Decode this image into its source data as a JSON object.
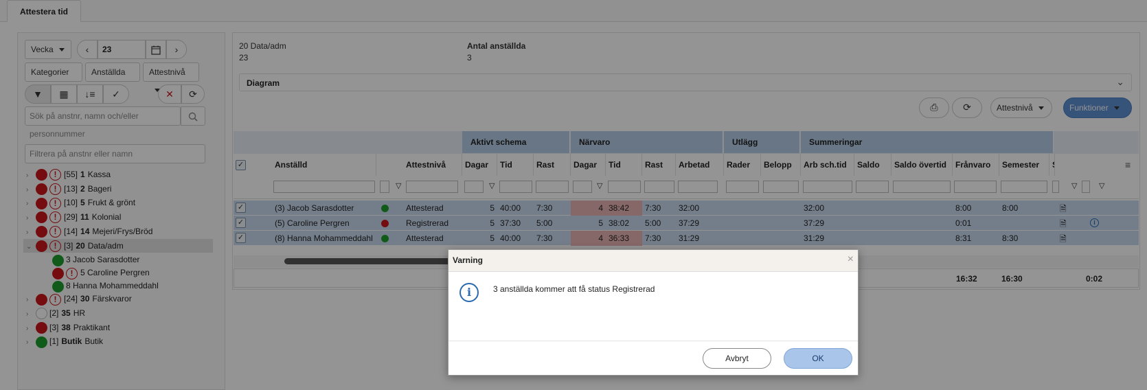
{
  "tab": {
    "label": "Attestera tid"
  },
  "filter": {
    "period": "Vecka",
    "week": "23",
    "kategorier": "Kategorier",
    "anstallda": "Anställda",
    "attestniva": "Attestnivå",
    "search_placeholder": "Sök på anstnr, namn och/eller personnummer",
    "filter_placeholder": "Filtrera på anstnr eller namn"
  },
  "tree": [
    {
      "count": "[55]",
      "code": "1",
      "name": "Kassa",
      "dots": [
        "red",
        "warn"
      ]
    },
    {
      "count": "[13]",
      "code": "2",
      "name": "Bageri",
      "dots": [
        "red",
        "warn"
      ]
    },
    {
      "count": "[10]",
      "code": "5",
      "name": "Frukt & grönt",
      "dots": [
        "red",
        "warn"
      ]
    },
    {
      "count": "[29]",
      "code": "11",
      "name": "Kolonial",
      "dots": [
        "red",
        "warn"
      ]
    },
    {
      "count": "[14]",
      "code": "14",
      "name": "Mejeri/Frys/Bröd",
      "dots": [
        "red",
        "warn"
      ]
    },
    {
      "count": "[3]",
      "code": "20",
      "name": "Data/adm",
      "dots": [
        "red",
        "warn"
      ],
      "expanded": true
    },
    {
      "count": "[24]",
      "code": "30",
      "name": "Färskvaror",
      "dots": [
        "red",
        "warn"
      ]
    },
    {
      "count": "[2]",
      "code": "35",
      "name": "HR",
      "dots": [
        "gray"
      ]
    },
    {
      "count": "[3]",
      "code": "38",
      "name": "Praktikant",
      "dots": [
        "red"
      ]
    },
    {
      "count": "[1]",
      "code": "Butik",
      "name": "Butik",
      "dots": [
        "green"
      ]
    }
  ],
  "tree_children": [
    {
      "label": "3 Jacob Sarasdotter",
      "dot": "green"
    },
    {
      "label": "5 Caroline Pergren",
      "dot": "red"
    },
    {
      "label": "8 Hanna Mohammeddahl",
      "dot": "green"
    }
  ],
  "summary": {
    "group_label": "20 Data/adm",
    "group_value": "23",
    "count_label": "Antal anställda",
    "count_value": "3",
    "diagram": "Diagram"
  },
  "toolbar": {
    "attestniva": "Attestnivå",
    "funktioner": "Funktioner"
  },
  "grid": {
    "groups": [
      "Aktivt schema",
      "Närvaro",
      "Utlägg",
      "Summeringar"
    ],
    "columns": [
      "Anställd",
      "Attestnivå",
      "Dagar",
      "Tid",
      "Rast",
      "Dagar",
      "Tid",
      "Rast",
      "Arbetad",
      "Rader",
      "Belopp",
      "Arb sch.tid",
      "Saldo",
      "Saldo övertid",
      "Frånvaro",
      "Semester",
      "S"
    ],
    "rows": [
      {
        "name": "(3) Jacob Sarasdotter",
        "status": "green",
        "attest": "Attesterad",
        "s_days": "5",
        "s_time": "40:00",
        "s_break": "7:30",
        "p_days": "4",
        "p_time": "38:42",
        "p_break": "7:30",
        "worked": "32:00",
        "arb": "32:00",
        "franvaro": "8:00",
        "semester": "8:00"
      },
      {
        "name": "(5) Caroline Pergren",
        "status": "red",
        "attest": "Registrerad",
        "s_days": "5",
        "s_time": "37:30",
        "s_break": "5:00",
        "p_days": "5",
        "p_time": "38:02",
        "p_break": "5:00",
        "worked": "37:29",
        "arb": "37:29",
        "franvaro": "0:01",
        "semester": ""
      },
      {
        "name": "(8) Hanna Mohammeddahl",
        "status": "green",
        "attest": "Attesterad",
        "s_days": "5",
        "s_time": "40:00",
        "s_break": "7:30",
        "p_days": "4",
        "p_time": "36:33",
        "p_break": "7:30",
        "worked": "31:29",
        "arb": "31:29",
        "franvaro": "8:31",
        "semester": "8:30"
      }
    ],
    "totals": {
      "franvaro": "16:32",
      "semester": "16:30",
      "extra": "0:02"
    }
  },
  "dialog": {
    "title": "Varning",
    "message": "3 anställda kommer att få status Registrerad",
    "cancel": "Avbryt",
    "ok": "OK"
  }
}
